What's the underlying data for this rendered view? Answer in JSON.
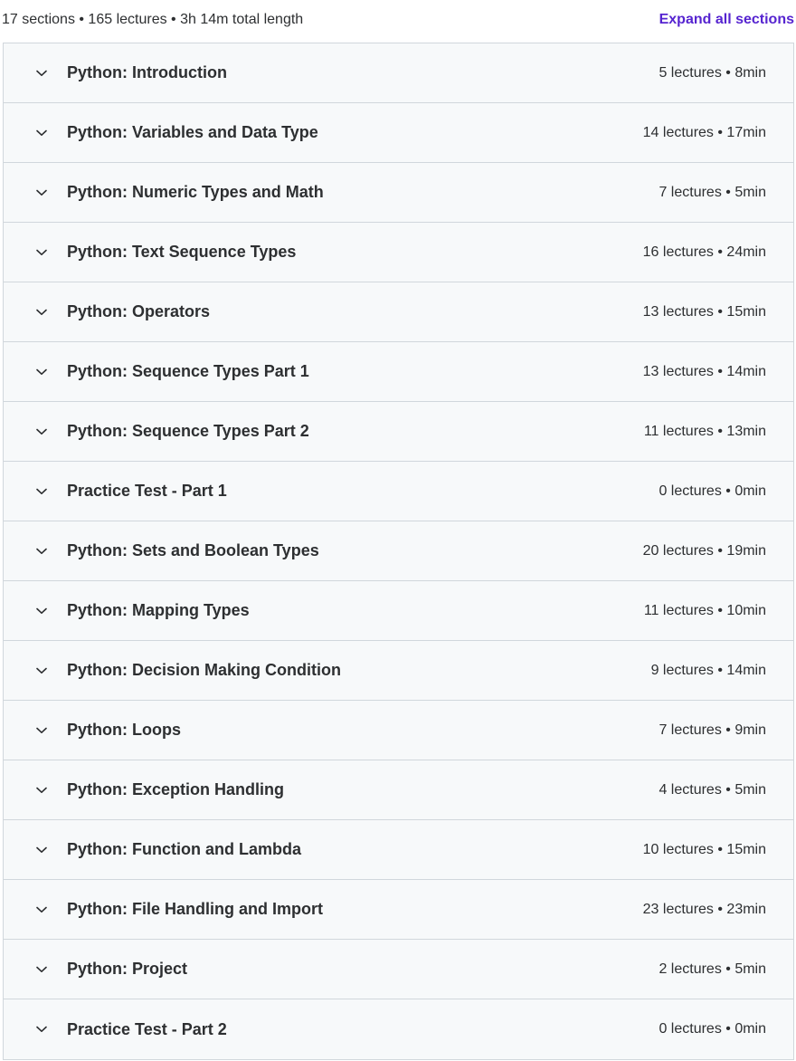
{
  "summary": {
    "text": "17 sections • 165 lectures • 3h 14m total length",
    "expand_label": "Expand all sections"
  },
  "icons": {
    "chevron": "chevron-down-icon"
  },
  "colors": {
    "accent": "#5624d0",
    "row_background": "#f7f9fa",
    "border": "#d1d7dc",
    "text": "#2d2f31"
  },
  "sections": [
    {
      "title": "Python: Introduction",
      "meta": "5 lectures • 8min"
    },
    {
      "title": "Python: Variables and Data Type",
      "meta": "14 lectures • 17min"
    },
    {
      "title": "Python: Numeric Types and Math",
      "meta": "7 lectures • 5min"
    },
    {
      "title": "Python: Text Sequence Types",
      "meta": "16 lectures • 24min"
    },
    {
      "title": "Python: Operators",
      "meta": "13 lectures • 15min"
    },
    {
      "title": "Python: Sequence Types Part 1",
      "meta": "13 lectures • 14min"
    },
    {
      "title": "Python: Sequence Types Part 2",
      "meta": "11 lectures • 13min"
    },
    {
      "title": "Practice Test - Part 1",
      "meta": "0 lectures • 0min"
    },
    {
      "title": "Python: Sets and Boolean Types",
      "meta": "20 lectures • 19min"
    },
    {
      "title": "Python: Mapping Types",
      "meta": "11 lectures • 10min"
    },
    {
      "title": "Python: Decision Making Condition",
      "meta": "9 lectures • 14min"
    },
    {
      "title": "Python: Loops",
      "meta": "7 lectures • 9min"
    },
    {
      "title": "Python: Exception Handling",
      "meta": "4 lectures • 5min"
    },
    {
      "title": "Python: Function and Lambda",
      "meta": "10 lectures • 15min"
    },
    {
      "title": "Python: File Handling and Import",
      "meta": "23 lectures • 23min"
    },
    {
      "title": "Python: Project",
      "meta": "2 lectures • 5min"
    },
    {
      "title": "Practice Test - Part 2",
      "meta": "0 lectures • 0min"
    }
  ]
}
